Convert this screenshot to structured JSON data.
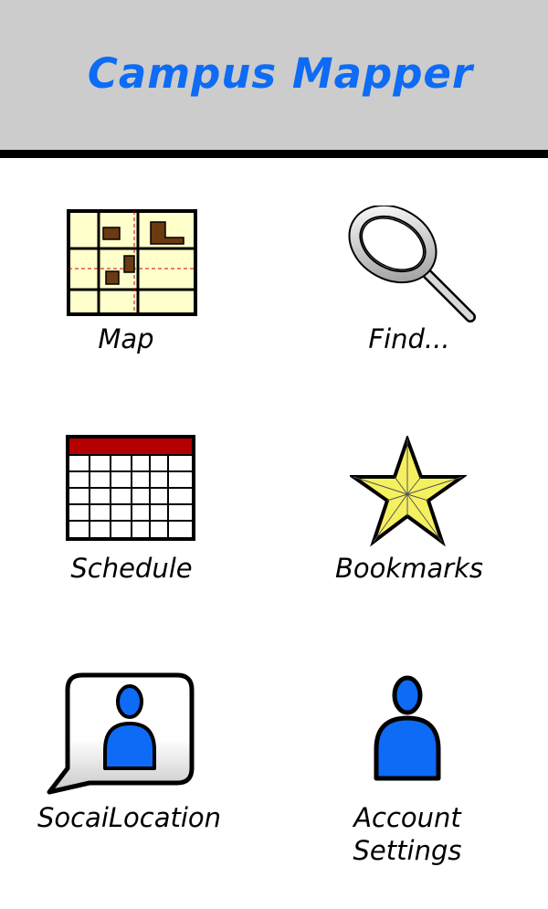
{
  "header": {
    "title": "Campus Mapper"
  },
  "menu": {
    "map": {
      "label": "Map",
      "icon": "map-icon"
    },
    "find": {
      "label": "Find...",
      "icon": "magnifying-glass-icon"
    },
    "schedule": {
      "label": "Schedule",
      "icon": "calendar-icon"
    },
    "bookmarks": {
      "label": "Bookmarks",
      "icon": "star-icon"
    },
    "social": {
      "label": "SocaiLocation",
      "icon": "person-speech-bubble-icon"
    },
    "account": {
      "label_line1": "Account",
      "label_line2": "Settings",
      "icon": "person-icon"
    }
  },
  "colors": {
    "header_bg": "#cccccc",
    "title": "#0d6bf5",
    "person_blue": "#0d6bf5",
    "calendar_red": "#b40000",
    "map_bg": "#ffffcc",
    "building_brown": "#6b3a10",
    "star_yellow": "#f5f060"
  }
}
